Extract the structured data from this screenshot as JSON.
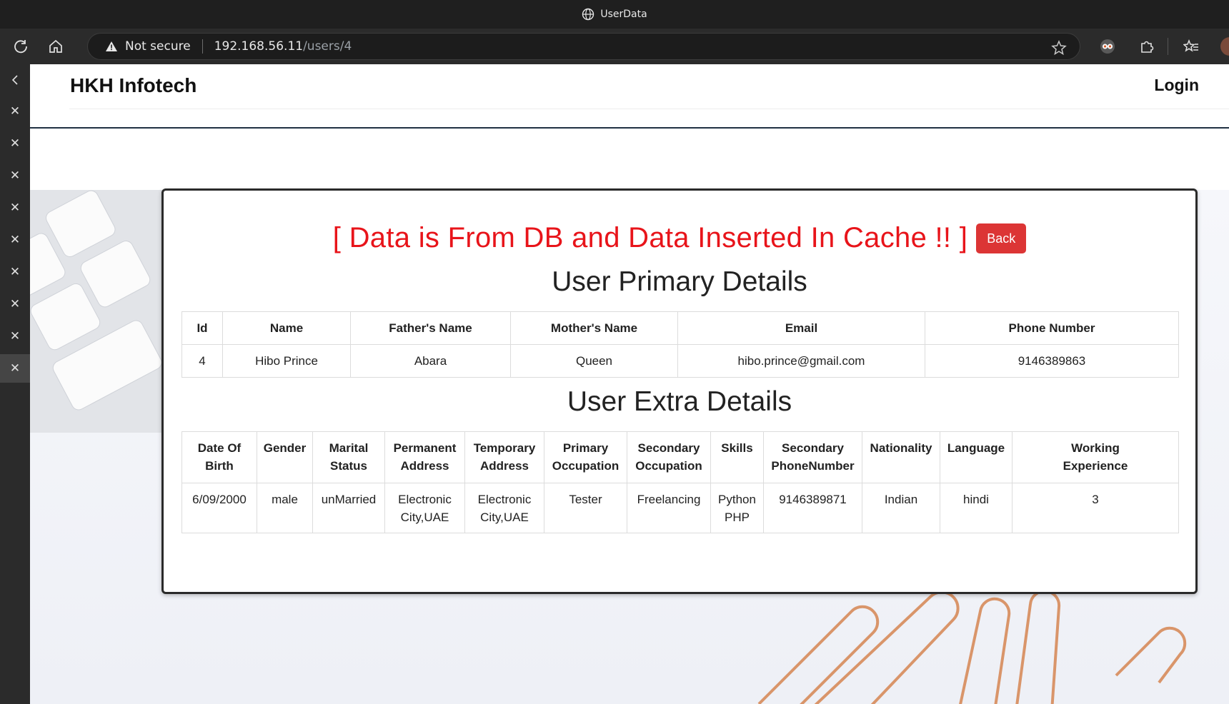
{
  "browser": {
    "tab_title": "UserData",
    "security_label": "Not secure",
    "url_host": "192.168.56.11",
    "url_path": "/users/4"
  },
  "navbar": {
    "brand": "HKH Infotech",
    "login_label": "Login"
  },
  "card": {
    "headline": "[ Data is From DB and Data Inserted In Cache !! ]",
    "back_label": "Back",
    "primary_title": "User Primary Details",
    "extra_title": "User Extra Details"
  },
  "primary_table": {
    "headers": [
      "Id",
      "Name",
      "Father's Name",
      "Mother's Name",
      "Email",
      "Phone Number"
    ],
    "row": [
      "4",
      "Hibo Prince",
      "Abara",
      "Queen",
      "hibo.prince@gmail.com",
      "9146389863"
    ]
  },
  "extra_table": {
    "headers": [
      [
        "Date Of",
        "Birth"
      ],
      [
        "Gender"
      ],
      [
        "Marital",
        "Status"
      ],
      [
        "Permanent",
        "Address"
      ],
      [
        "Temporary",
        "Address"
      ],
      [
        "Primary",
        "Occupation"
      ],
      [
        "Secondary",
        "Occupation"
      ],
      [
        "Skills"
      ],
      [
        "Secondary",
        "PhoneNumber"
      ],
      [
        "Nationality"
      ],
      [
        "Language"
      ],
      [
        "Working",
        "Experience"
      ]
    ],
    "row": [
      [
        "6/09/2000"
      ],
      [
        "male"
      ],
      [
        "unMarried"
      ],
      [
        "Electronic",
        "City,UAE"
      ],
      [
        "Electronic",
        "City,UAE"
      ],
      [
        "Tester"
      ],
      [
        "Freelancing"
      ],
      [
        "Python",
        "PHP"
      ],
      [
        "9146389871"
      ],
      [
        "Indian"
      ],
      [
        "hindi"
      ],
      [
        "3"
      ]
    ]
  },
  "colors": {
    "headline_red": "#e8141a",
    "back_button": "#dc3535",
    "navbar_border": "#233344"
  },
  "icons": {
    "titlebar": "globe-icon",
    "toolbar": [
      "reload-icon",
      "home-icon",
      "warning-icon",
      "star-icon",
      "profile-icon",
      "extensions-icon",
      "favorites-icon"
    ],
    "sidebar": [
      "chevron-left-icon",
      "close-icon"
    ]
  }
}
